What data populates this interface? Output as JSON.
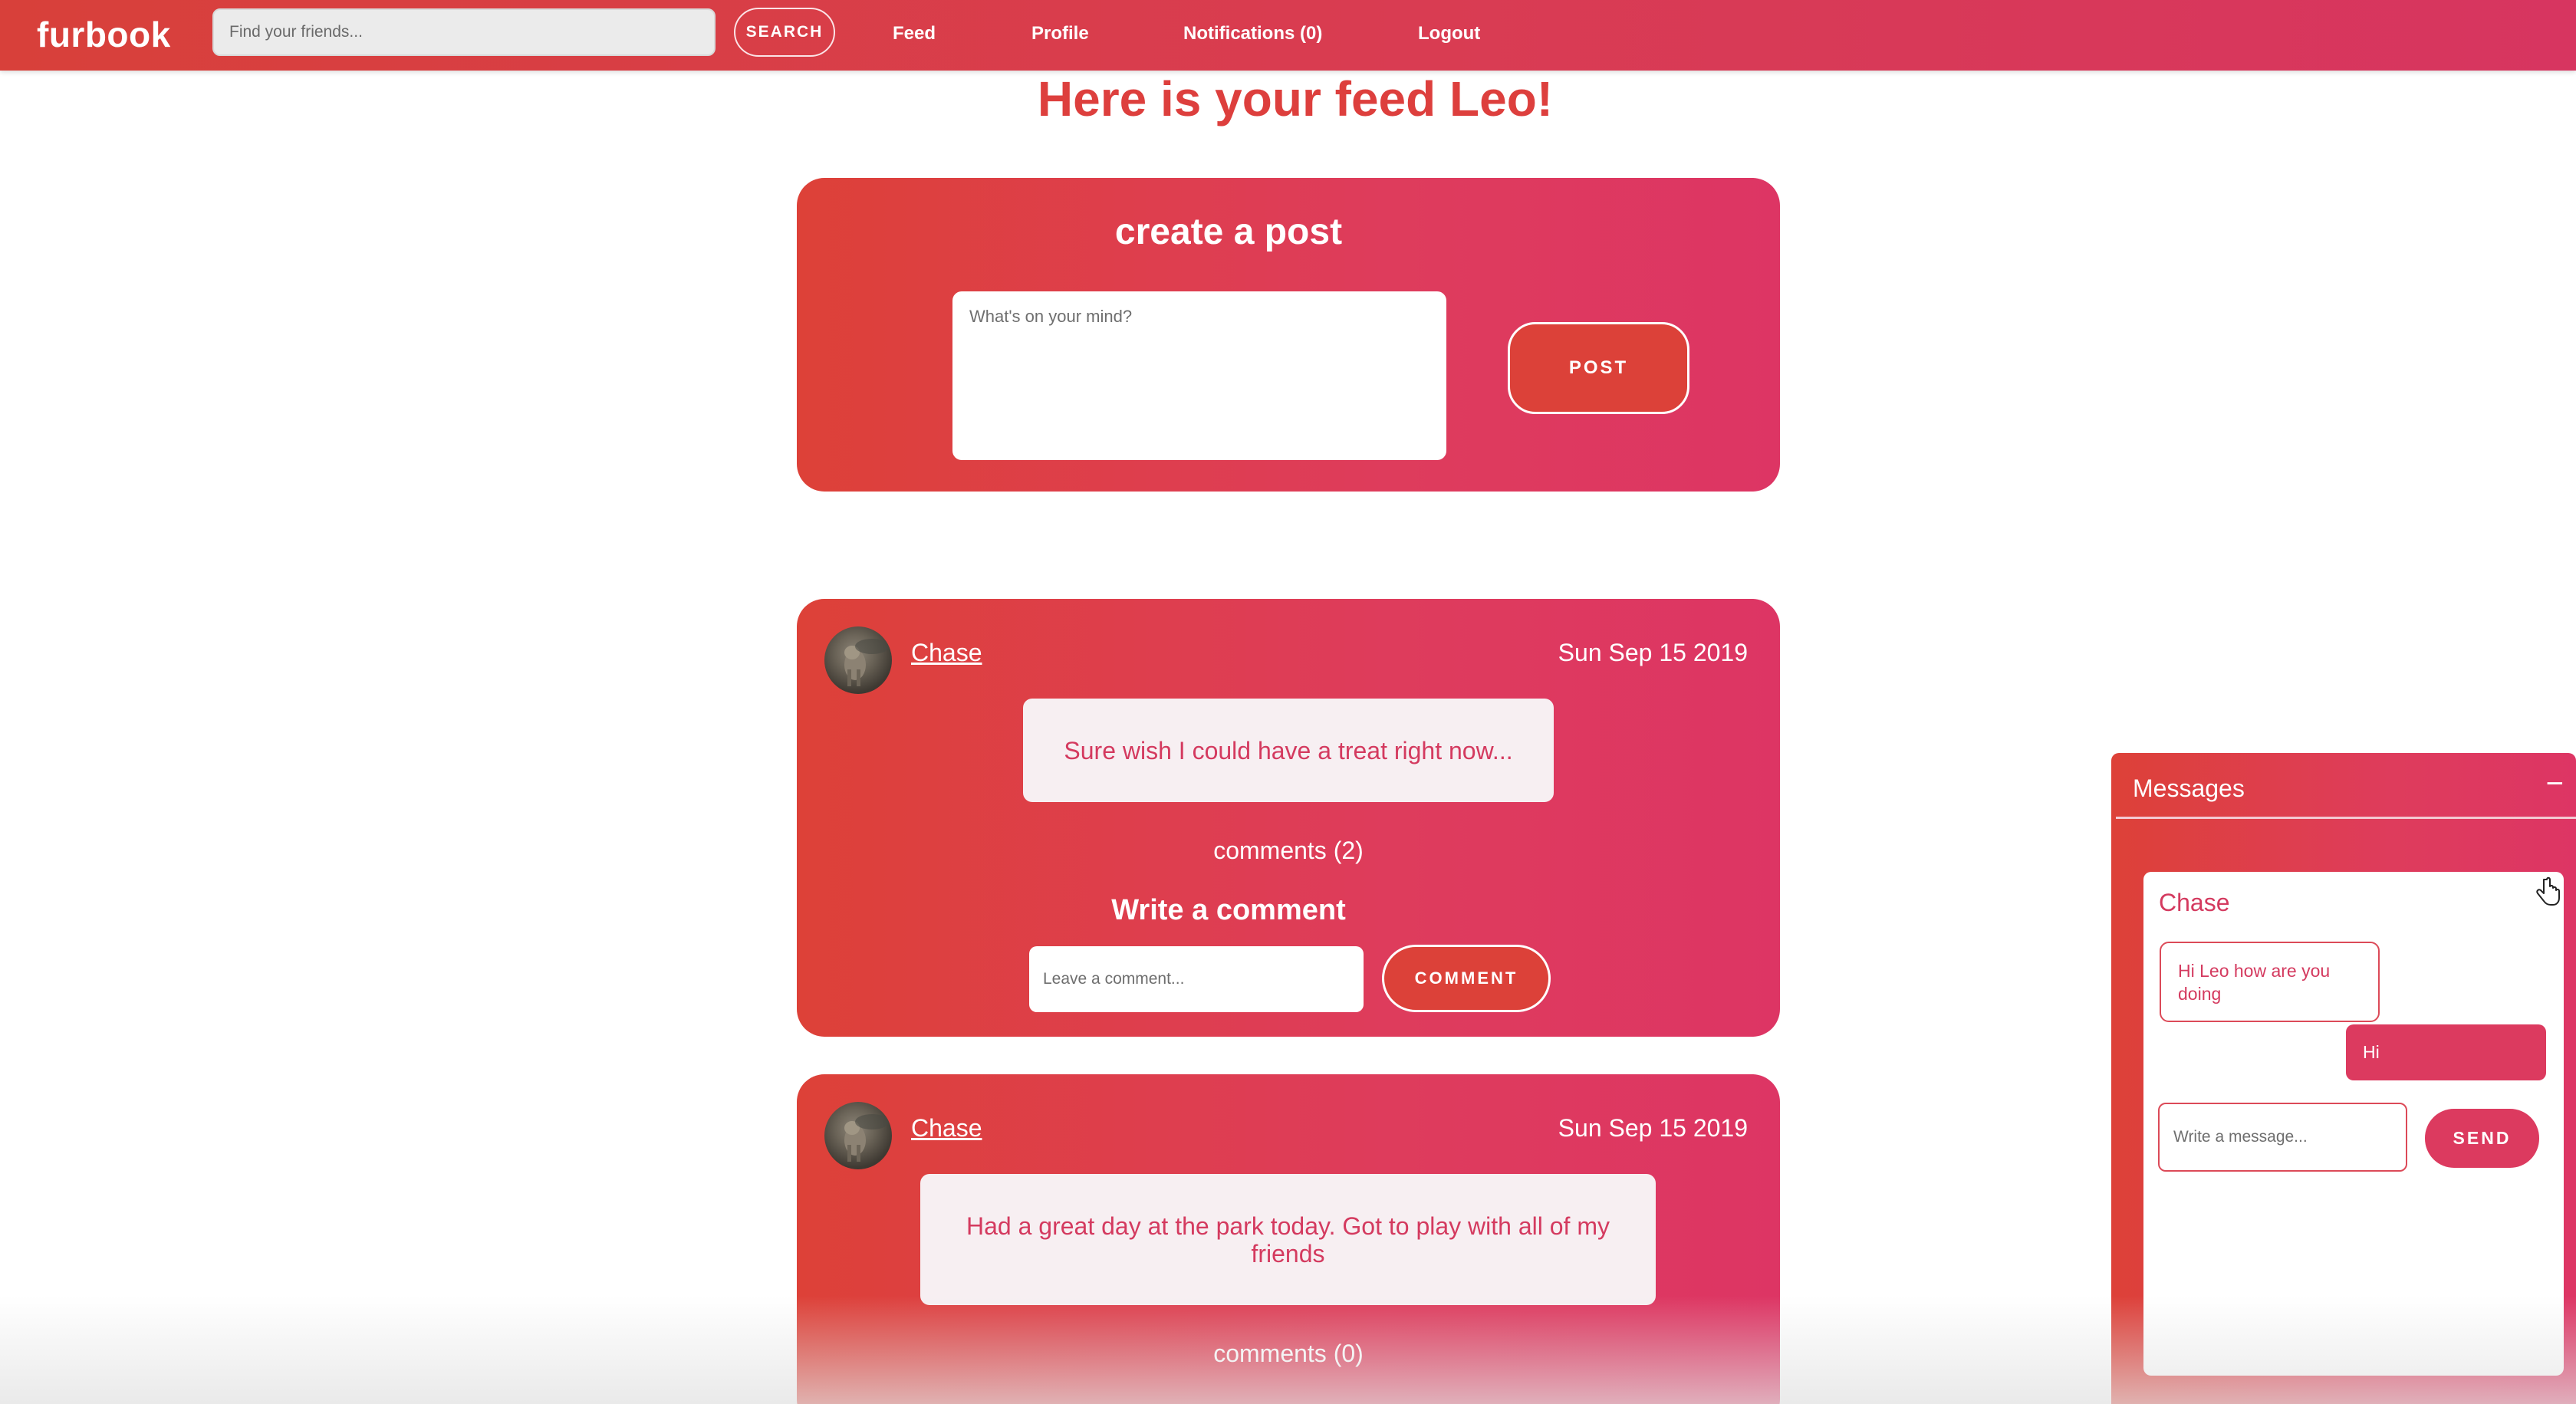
{
  "colors": {
    "brand_gradient_start": "#dd4138",
    "brand_gradient_end": "#dd3564",
    "heading_red": "#dd3f3d",
    "post_text_pink": "#d43a5f"
  },
  "navbar": {
    "brand": "furbook",
    "search_placeholder": "Find your friends...",
    "search_label": "SEARCH",
    "links": {
      "feed": "Feed",
      "profile": "Profile",
      "notifications": "Notifications (0)",
      "logout": "Logout"
    }
  },
  "feed": {
    "heading": "Here is your feed Leo!"
  },
  "create_post": {
    "title": "create a post",
    "placeholder": "What's on your mind?",
    "post_label": "POST"
  },
  "posts": [
    {
      "author": "Chase",
      "date": "Sun Sep 15 2019",
      "body": "Sure wish I could have a treat right now...",
      "comments_label": "comments (2)",
      "write_comment_title": "Write a comment",
      "comment_placeholder": "Leave a comment...",
      "comment_label": "COMMENT"
    },
    {
      "author": "Chase",
      "date": "Sun Sep 15 2019",
      "body": "Had a great day at the park today. Got to play with all of my friends",
      "comments_label": "comments (0)"
    }
  ],
  "messages": {
    "title": "Messages",
    "minimize_symbol": "−",
    "chat": {
      "name": "Chase",
      "received": "Hi Leo how are you doing",
      "sent": "Hi",
      "input_placeholder": "Write a message...",
      "send_label": "SEND"
    }
  },
  "icons": {
    "minimize": "minimize-icon",
    "cursor": "hand-cursor-icon",
    "avatar": "dog-avatar"
  }
}
